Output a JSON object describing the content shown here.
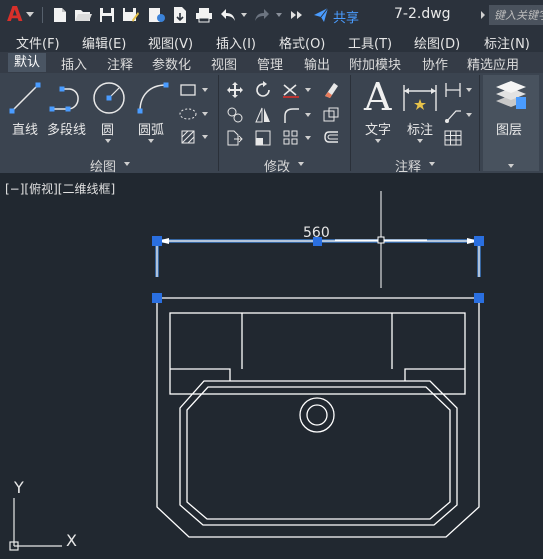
{
  "app": {
    "logo_letter": "A",
    "share_label": "共享",
    "filename": "7-2.dwg",
    "search_placeholder": "键入关键字"
  },
  "menu": [
    "文件(F)",
    "编辑(E)",
    "视图(V)",
    "插入(I)",
    "格式(O)",
    "工具(T)",
    "绘图(D)",
    "标注(N)"
  ],
  "tabs": [
    "默认",
    "插入",
    "注释",
    "参数化",
    "视图",
    "管理",
    "输出",
    "附加模块",
    "协作",
    "精选应用"
  ],
  "active_tab": "默认",
  "ribbon": {
    "draw": {
      "line": "直线",
      "polyline": "多段线",
      "circle": "圆",
      "arc": "圆弧",
      "panel": "绘图"
    },
    "modify": {
      "panel": "修改"
    },
    "annotation": {
      "text": "文字",
      "dimension": "标注",
      "panel": "注释"
    },
    "layers": {
      "label": "图层"
    }
  },
  "viewport": {
    "label": "[−][俯视][二维线框]"
  },
  "drawing": {
    "dimension_text": "560"
  },
  "ucs": {
    "x": "X",
    "y": "Y"
  },
  "colors": {
    "accent": "#1e6fd9",
    "grip": "#2a6fe0",
    "selection": "#4a9cff",
    "logo": "#d9302a"
  }
}
